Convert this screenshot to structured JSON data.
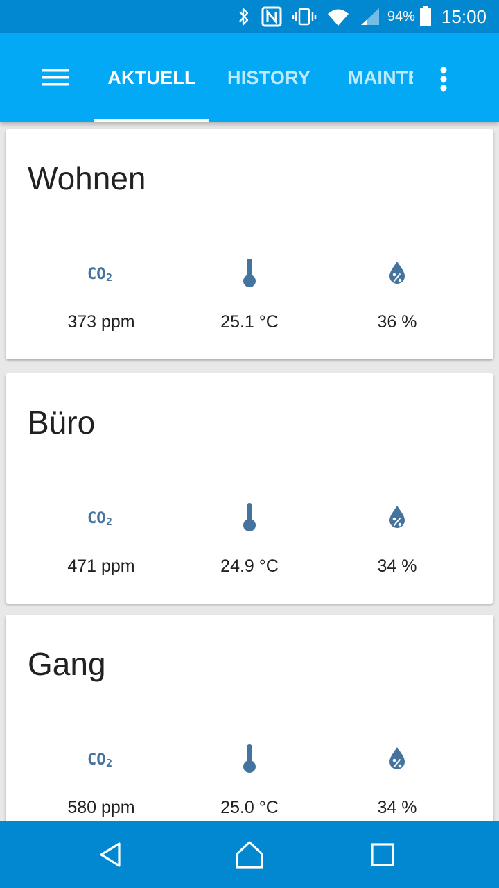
{
  "status_bar": {
    "icons": [
      "bluetooth-icon",
      "nfc-icon",
      "vibrate-icon",
      "wifi-icon",
      "signal-icon",
      "battery-icon"
    ],
    "battery": "94%",
    "time": "15:00"
  },
  "app_bar": {
    "menu_icon": "hamburger-menu-icon",
    "tabs": [
      {
        "label": "AKTUELL",
        "active": true
      },
      {
        "label": "HISTORY",
        "active": false
      },
      {
        "label": "MAINTENANCE",
        "active": false
      }
    ],
    "overflow_icon": "more-vert-icon"
  },
  "rooms": [
    {
      "name": "Wohnen",
      "co2": "373 ppm",
      "temperature": "25.1 °C",
      "humidity": "36 %"
    },
    {
      "name": "Büro",
      "co2": "471 ppm",
      "temperature": "24.9 °C",
      "humidity": "34 %"
    },
    {
      "name": "Gang",
      "co2": "580 ppm",
      "temperature": "25.0 °C",
      "humidity": "34 %"
    }
  ],
  "sensor_icons": [
    "co2-icon",
    "thermometer-icon",
    "humidity-icon"
  ],
  "colors": {
    "status_bar": "#0288d1",
    "app_bar": "#03a9f4",
    "icon": "#44739e",
    "nav_bar": "#0288d1"
  },
  "nav_bar": {
    "icons": [
      "back-icon",
      "home-icon",
      "recents-icon"
    ]
  }
}
